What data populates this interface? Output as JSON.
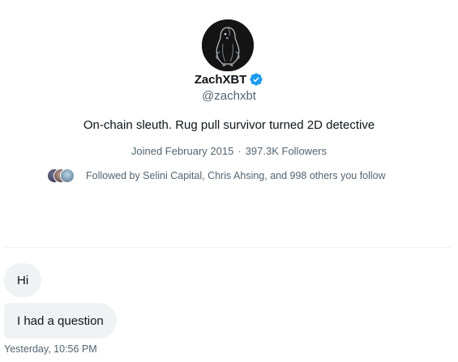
{
  "profile": {
    "display_name": "ZachXBT",
    "handle": "@zachxbt",
    "bio": "On-chain sleuth. Rug pull survivor turned 2D detective",
    "joined": "Joined February 2015",
    "separator": "·",
    "followers": "397.3K Followers",
    "followed_by": "Followed by Selini Capital, Chris Ahsing, and 998 others you follow",
    "verified_color": "#1d9bf0",
    "avatar_icon": "penguin-icon"
  },
  "messages": [
    {
      "text": "Hi"
    },
    {
      "text": "I had a question"
    }
  ],
  "timestamp": "Yesterday, 10:56 PM"
}
